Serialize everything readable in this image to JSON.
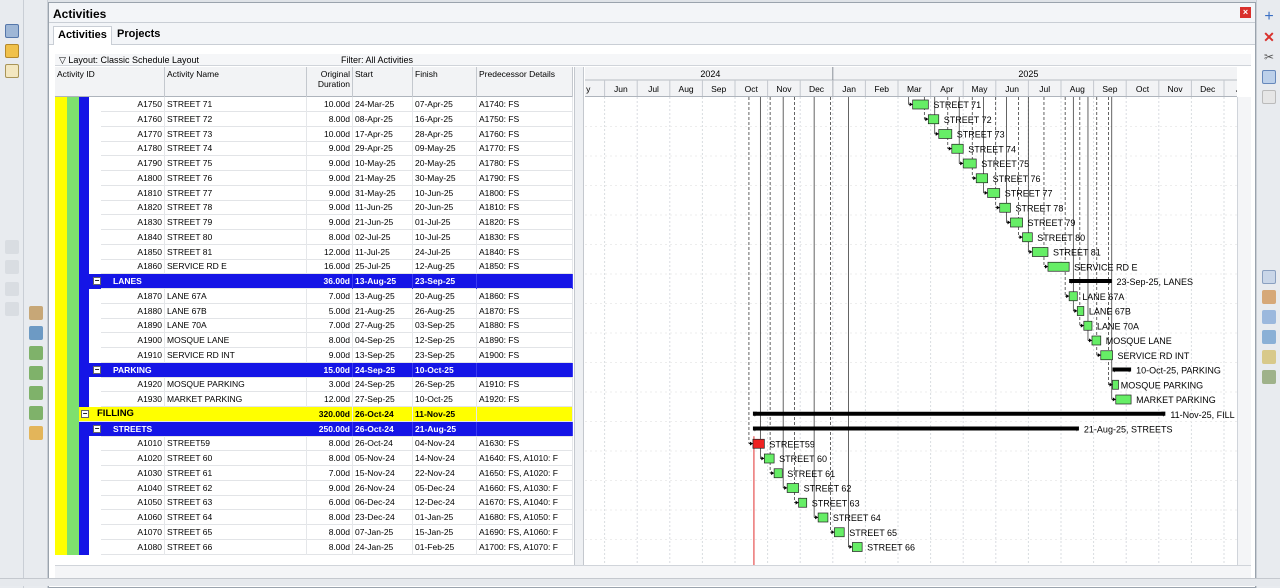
{
  "panel": {
    "title": "Activities",
    "close_label": "×"
  },
  "tabs": [
    {
      "label": "Activities"
    },
    {
      "label": "Projects"
    }
  ],
  "layout_bar": {
    "layout": "Layout: Classic Schedule Layout",
    "filter": "Filter: All Activities"
  },
  "columns": {
    "id": "Activity ID",
    "name": "Activity Name",
    "duration": "Original Duration",
    "start": "Start",
    "finish": "Finish",
    "pred": "Predecessor Details"
  },
  "timescale": {
    "years": [
      "2024",
      "2025"
    ],
    "months": [
      "y",
      "Jun",
      "Jul",
      "Aug",
      "Sep",
      "Oct",
      "Nov",
      "Dec",
      "Jan",
      "Feb",
      "Mar",
      "Apr",
      "May",
      "Jun",
      "Jul",
      "Aug",
      "Sep",
      "Oct",
      "Nov",
      "Dec",
      "Ja"
    ]
  },
  "rows": [
    {
      "kind": "act",
      "id": "A1750",
      "name": "STREET 71",
      "dur": "10.00d",
      "start": "24-Mar-25",
      "finish": "07-Apr-25",
      "pred": "A1740: FS",
      "bar_label": "STREET 71",
      "s": 10.45,
      "f": 10.93
    },
    {
      "kind": "act",
      "id": "A1760",
      "name": "STREET 72",
      "dur": "8.00d",
      "start": "08-Apr-25",
      "finish": "16-Apr-25",
      "pred": "A1750: FS",
      "bar_label": "STREET 72",
      "s": 10.93,
      "f": 11.25
    },
    {
      "kind": "act",
      "id": "A1770",
      "name": "STREET 73",
      "dur": "10.00d",
      "start": "17-Apr-25",
      "finish": "28-Apr-25",
      "pred": "A1760: FS",
      "bar_label": "STREET 73",
      "s": 11.25,
      "f": 11.65
    },
    {
      "kind": "act",
      "id": "A1780",
      "name": "STREET 74",
      "dur": "9.00d",
      "start": "29-Apr-25",
      "finish": "09-May-25",
      "pred": "A1770: FS",
      "bar_label": "STREET 74",
      "s": 11.65,
      "f": 12.0
    },
    {
      "kind": "act",
      "id": "A1790",
      "name": "STREET 75",
      "dur": "9.00d",
      "start": "10-May-25",
      "finish": "20-May-25",
      "pred": "A1780: FS",
      "bar_label": "STREET 75",
      "s": 12.0,
      "f": 12.4
    },
    {
      "kind": "act",
      "id": "A1800",
      "name": "STREET 76",
      "dur": "9.00d",
      "start": "21-May-25",
      "finish": "30-May-25",
      "pred": "A1790: FS",
      "bar_label": "STREET 76",
      "s": 12.4,
      "f": 12.75
    },
    {
      "kind": "act",
      "id": "A1810",
      "name": "STREET 77",
      "dur": "9.00d",
      "start": "31-May-25",
      "finish": "10-Jun-25",
      "pred": "A1800: FS",
      "bar_label": "STREET 77",
      "s": 12.75,
      "f": 13.12
    },
    {
      "kind": "act",
      "id": "A1820",
      "name": "STREET 78",
      "dur": "9.00d",
      "start": "11-Jun-25",
      "finish": "20-Jun-25",
      "pred": "A1810: FS",
      "bar_label": "STREET 78",
      "s": 13.12,
      "f": 13.45
    },
    {
      "kind": "act",
      "id": "A1830",
      "name": "STREET 79",
      "dur": "9.00d",
      "start": "21-Jun-25",
      "finish": "01-Jul-25",
      "pred": "A1820: FS",
      "bar_label": "STREET 79",
      "s": 13.45,
      "f": 13.82
    },
    {
      "kind": "act",
      "id": "A1840",
      "name": "STREET 80",
      "dur": "8.00d",
      "start": "02-Jul-25",
      "finish": "10-Jul-25",
      "pred": "A1830: FS",
      "bar_label": "STREET 80",
      "s": 13.82,
      "f": 14.12
    },
    {
      "kind": "act",
      "id": "A1850",
      "name": "STREET 81",
      "dur": "12.00d",
      "start": "11-Jul-25",
      "finish": "24-Jul-25",
      "pred": "A1840: FS",
      "bar_label": "STREET 81",
      "s": 14.12,
      "f": 14.6
    },
    {
      "kind": "act",
      "id": "A1860",
      "name": "SERVICE RD E",
      "dur": "16.00d",
      "start": "25-Jul-25",
      "finish": "12-Aug-25",
      "pred": "A1850: FS",
      "bar_label": "SERVICE RD E",
      "s": 14.6,
      "f": 15.25
    },
    {
      "kind": "wbs",
      "level": 2,
      "name": "LANES",
      "dur": "36.00d",
      "start": "13-Aug-25",
      "finish": "23-Sep-25",
      "pred": "",
      "bar_label": "23-Sep-25, LANES",
      "s": 15.25,
      "f": 16.55
    },
    {
      "kind": "act",
      "id": "A1870",
      "name": "LANE 67A",
      "dur": "7.00d",
      "start": "13-Aug-25",
      "finish": "20-Aug-25",
      "pred": "A1860: FS",
      "bar_label": "LANE 67A",
      "s": 15.25,
      "f": 15.5
    },
    {
      "kind": "act",
      "id": "A1880",
      "name": "LANE 67B",
      "dur": "5.00d",
      "start": "21-Aug-25",
      "finish": "26-Aug-25",
      "pred": "A1870: FS",
      "bar_label": "LANE 67B",
      "s": 15.5,
      "f": 15.7
    },
    {
      "kind": "act",
      "id": "A1890",
      "name": "LANE 70A",
      "dur": "7.00d",
      "start": "27-Aug-25",
      "finish": "03-Sep-25",
      "pred": "A1880: FS",
      "bar_label": "LANE 70A",
      "s": 15.7,
      "f": 15.95
    },
    {
      "kind": "act",
      "id": "A1900",
      "name": "MOSQUE LANE",
      "dur": "8.00d",
      "start": "04-Sep-25",
      "finish": "12-Sep-25",
      "pred": "A1890: FS",
      "bar_label": "MOSQUE LANE",
      "s": 15.95,
      "f": 16.22
    },
    {
      "kind": "act",
      "id": "A1910",
      "name": "SERVICE RD INT",
      "dur": "9.00d",
      "start": "13-Sep-25",
      "finish": "23-Sep-25",
      "pred": "A1900: FS",
      "bar_label": "SERVICE RD INT",
      "s": 16.22,
      "f": 16.58
    },
    {
      "kind": "wbs",
      "level": 2,
      "name": "PARKING",
      "dur": "15.00d",
      "start": "24-Sep-25",
      "finish": "10-Oct-25",
      "pred": "",
      "bar_label": "10-Oct-25, PARKING",
      "s": 16.58,
      "f": 17.15
    },
    {
      "kind": "act",
      "id": "A1920",
      "name": "MOSQUE PARKING",
      "dur": "3.00d",
      "start": "24-Sep-25",
      "finish": "26-Sep-25",
      "pred": "A1910: FS",
      "bar_label": "MOSQUE PARKING",
      "s": 16.58,
      "f": 16.68
    },
    {
      "kind": "act",
      "id": "A1930",
      "name": "MARKET PARKING",
      "dur": "12.00d",
      "start": "27-Sep-25",
      "finish": "10-Oct-25",
      "pred": "A1920: FS",
      "bar_label": "MARKET PARKING",
      "s": 16.68,
      "f": 17.15
    },
    {
      "kind": "wbs",
      "level": 1,
      "name": "FILLING",
      "dur": "320.00d",
      "start": "26-Oct-24",
      "finish": "11-Nov-25",
      "pred": "",
      "bar_label": "11-Nov-25, FILL",
      "s": 5.55,
      "f": 18.2
    },
    {
      "kind": "wbs",
      "level": 2,
      "name": "STREETS",
      "dur": "250.00d",
      "start": "26-Oct-24",
      "finish": "21-Aug-25",
      "pred": "",
      "bar_label": "21-Aug-25, STREETS",
      "s": 5.55,
      "f": 15.55
    },
    {
      "kind": "act",
      "id": "A1010",
      "name": "STREET59",
      "dur": "8.00d",
      "start": "26-Oct-24",
      "finish": "04-Nov-24",
      "pred": "A1630: FS",
      "bar_label": "STREET59",
      "s": 5.55,
      "f": 5.9,
      "critical": true
    },
    {
      "kind": "act",
      "id": "A1020",
      "name": "STREET 60",
      "dur": "8.00d",
      "start": "05-Nov-24",
      "finish": "14-Nov-24",
      "pred": "A1640: FS, A1010: F",
      "bar_label": "STREET 60",
      "s": 5.9,
      "f": 6.2
    },
    {
      "kind": "act",
      "id": "A1030",
      "name": "STREET 61",
      "dur": "7.00d",
      "start": "15-Nov-24",
      "finish": "22-Nov-24",
      "pred": "A1650: FS, A1020: F",
      "bar_label": "STREET 61",
      "s": 6.2,
      "f": 6.45
    },
    {
      "kind": "act",
      "id": "A1040",
      "name": "STREET 62",
      "dur": "9.00d",
      "start": "26-Nov-24",
      "finish": "05-Dec-24",
      "pred": "A1660: FS, A1030: F",
      "bar_label": "STREET 62",
      "s": 6.6,
      "f": 6.95
    },
    {
      "kind": "act",
      "id": "A1050",
      "name": "STREET 63",
      "dur": "6.00d",
      "start": "06-Dec-24",
      "finish": "12-Dec-24",
      "pred": "A1670: FS, A1040: F",
      "bar_label": "STREET 63",
      "s": 6.95,
      "f": 7.2
    },
    {
      "kind": "act",
      "id": "A1060",
      "name": "STREET 64",
      "dur": "8.00d",
      "start": "23-Dec-24",
      "finish": "01-Jan-25",
      "pred": "A1680: FS, A1050: F",
      "bar_label": "STREET 64",
      "s": 7.55,
      "f": 7.85
    },
    {
      "kind": "act",
      "id": "A1070",
      "name": "STREET 65",
      "dur": "8.00d",
      "start": "07-Jan-25",
      "finish": "15-Jan-25",
      "pred": "A1690: FS, A1060: F",
      "bar_label": "STREET 65",
      "s": 8.05,
      "f": 8.35
    },
    {
      "kind": "act",
      "id": "A1080",
      "name": "STREET 66",
      "dur": "8.00d",
      "start": "24-Jan-25",
      "finish": "01-Feb-25",
      "pred": "A1700: FS, A1070: F",
      "bar_label": "STREET 66",
      "s": 8.6,
      "f": 8.9
    }
  ],
  "colors": {
    "wbs_blue": "#1515e6",
    "wbs_yellow": "#ffff00",
    "bar_green": "#66ee66",
    "bar_critical": "#ee2222",
    "summary": "#000000"
  }
}
